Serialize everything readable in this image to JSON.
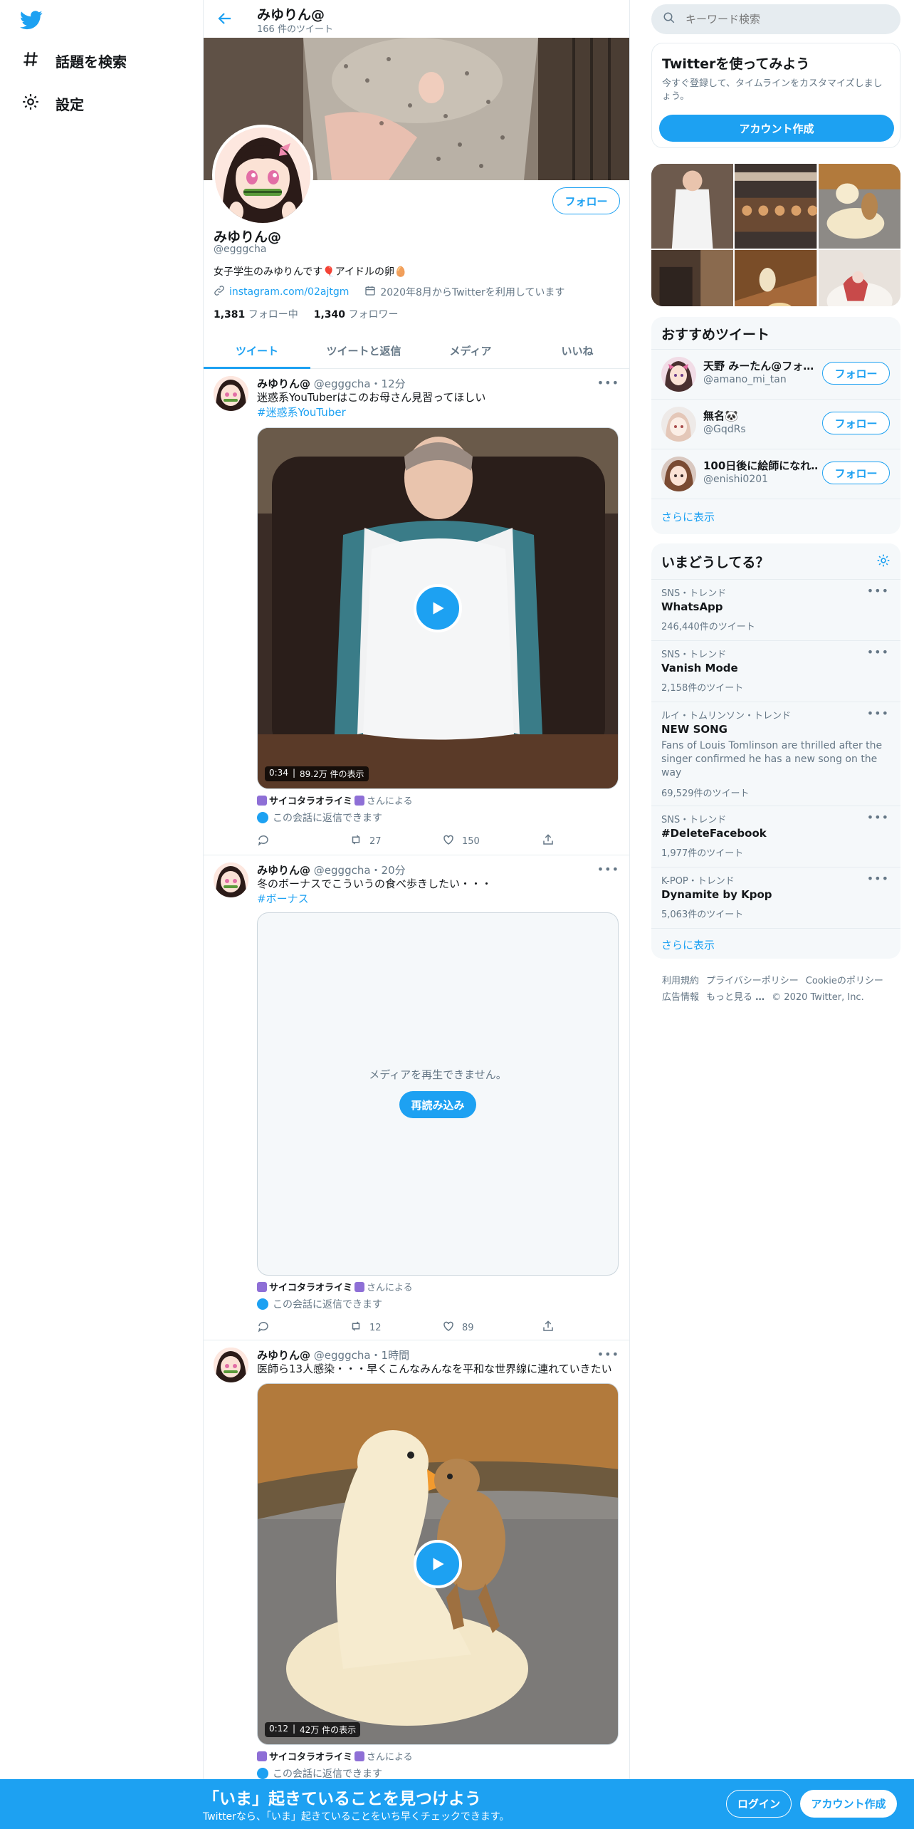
{
  "nav": {
    "explore_label": "話題を検索",
    "settings_label": "設定"
  },
  "profile_header": {
    "title": "みゆりん@",
    "tweet_count": "166 件のツイート"
  },
  "profile": {
    "name": "みゆりん@",
    "handle": "@egggcha",
    "bio": "女子学生のみゆりんです🎈アイドルの卵🥚",
    "link": "instagram.com/02ajtgm",
    "joined": "2020年8月からTwitterを利用しています",
    "following_count": "1,381",
    "following_label": "フォロー中",
    "followers_count": "1,340",
    "followers_label": "フォロワー",
    "follow_button": "フォロー"
  },
  "tabs": [
    "ツイート",
    "ツイートと返信",
    "メディア",
    "いいね"
  ],
  "tweets": [
    {
      "name": "みゆりん@",
      "handle": "@egggcha",
      "time": "・12分",
      "text": "迷惑系YouTuberはこのお母さん見習ってほしい",
      "hashtag": "#迷惑系YouTuber",
      "duration": "0:34",
      "views": "89.2万 件の表示",
      "credit_name": "サイコタラオライミ",
      "credit_suffix": "さんによる",
      "reply_note": "この会話に返信できます",
      "retweets": "27",
      "likes": "150"
    },
    {
      "name": "みゆりん@",
      "handle": "@egggcha",
      "time": "・20分",
      "text": "冬のボーナスでこういうの食べ歩きしたい・・・",
      "hashtag": "#ボーナス",
      "media_error": "メディアを再生できません。",
      "reload_button": "再読み込み",
      "credit_name": "サイコタラオライミ",
      "credit_suffix": "さんによる",
      "reply_note": "この会話に返信できます",
      "retweets": "12",
      "likes": "89"
    },
    {
      "name": "みゆりん@",
      "handle": "@egggcha",
      "time": "・1時間",
      "text": "医師ら13人感染・・・早くこんなみんなを平和な世界線に連れていきたい",
      "duration": "0:12",
      "views": "42万 件の表示",
      "credit_name": "サイコタラオライミ",
      "credit_suffix": "さんによる",
      "reply_note": "この会話に返信できます"
    }
  ],
  "search": {
    "placeholder": "キーワード検索"
  },
  "signup_panel": {
    "title": "Twitterを使ってみよう",
    "description": "今すぐ登録して、タイムラインをカスタマイズしましょう。",
    "button": "アカウント作成"
  },
  "recommended": {
    "title": "おすすめツイート",
    "users": [
      {
        "name": "天野 みーたん@フォ…",
        "handle": "@amano_mi_tan"
      },
      {
        "name": "無名🐼",
        "handle": "@GqdRs"
      },
      {
        "name": "100日後に絵師になれ…",
        "handle": "@enishi0201"
      }
    ],
    "follow_label": "フォロー",
    "show_more": "さらに表示"
  },
  "trends": {
    "title": "いまどうしてる？",
    "items": [
      {
        "category": "SNS・トレンド",
        "name": "WhatsApp",
        "desc": "",
        "count": "246,440件のツイート"
      },
      {
        "category": "SNS・トレンド",
        "name": "Vanish Mode",
        "desc": "",
        "count": "2,158件のツイート"
      },
      {
        "category": "ルイ・トムリンソン・トレンド",
        "name": "NEW SONG",
        "desc": "Fans of Louis Tomlinson are thrilled after the singer confirmed he has a new song on the way",
        "count": "69,529件のツイート"
      },
      {
        "category": "SNS・トレンド",
        "name": "#DeleteFacebook",
        "desc": "",
        "count": "1,977件のツイート"
      },
      {
        "category": "K-POP・トレンド",
        "name": "Dynamite by Kpop",
        "desc": "",
        "count": "5,063件のツイート"
      }
    ],
    "show_more": "さらに表示"
  },
  "footer": {
    "links_row1": [
      "利用規約",
      "プライバシーポリシー",
      "Cookieのポリシー"
    ],
    "links_row2": [
      "広告情報",
      "もっと見る"
    ],
    "copyright": "© 2020 Twitter, Inc."
  },
  "bottom_bar": {
    "headline": "「いま」起きていることを見つけよう",
    "subtext": "Twitterなら、「いま」起きていることをいち早くチェックできます。",
    "login": "ログイン",
    "signup": "アカウント作成"
  },
  "colors": {
    "accent": "#1da1f2",
    "text": "#14171a",
    "secondary": "#657786",
    "border": "#e6ecf0",
    "panel_bg": "#f5f8fa"
  }
}
